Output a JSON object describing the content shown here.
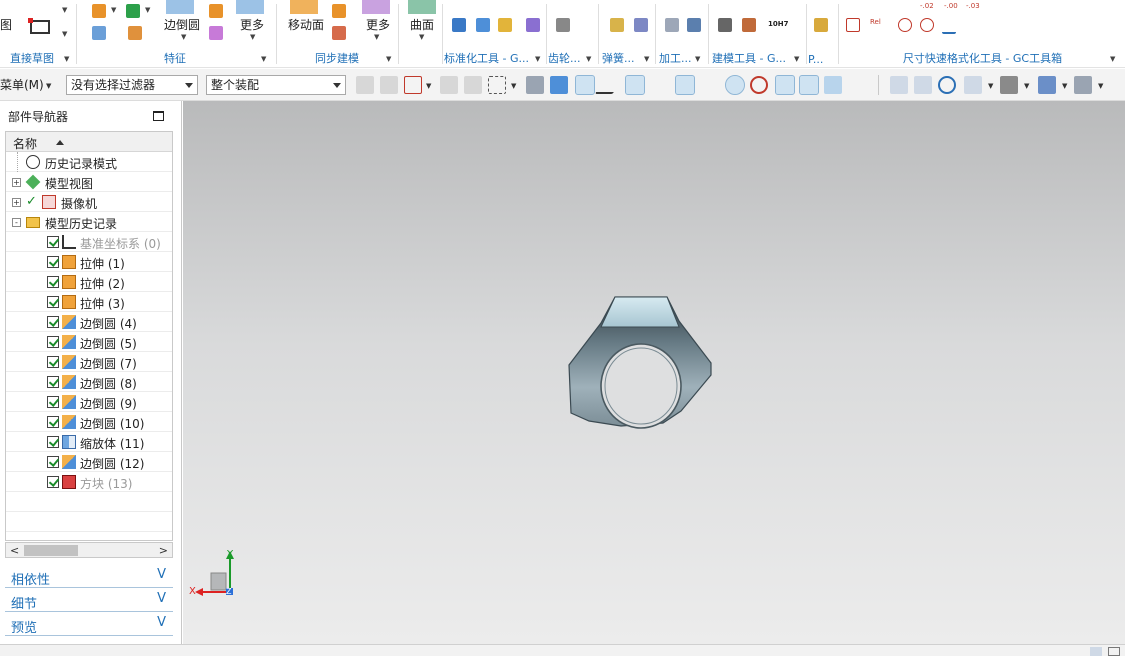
{
  "ribbon": {
    "groups": [
      {
        "id": "sketch",
        "label": "直接草图"
      },
      {
        "id": "feature",
        "label": "特征"
      },
      {
        "id": "sync",
        "label": "同步建模"
      },
      {
        "id": "standard",
        "label": "标准化工具 - G..."
      },
      {
        "id": "gear",
        "label": "齿轮..."
      },
      {
        "id": "spring",
        "label": "弹簧..."
      },
      {
        "id": "machining",
        "label": "加工..."
      },
      {
        "id": "modeling",
        "label": "建模工具 - G..."
      },
      {
        "id": "p",
        "label": "P..."
      },
      {
        "id": "dim",
        "label": "尺寸快速格式化工具 - GC工具箱"
      }
    ],
    "buttons": {
      "edge_blend": "边倒圆",
      "more_feature": "更多",
      "move_face": "移动面",
      "more_sync": "更多",
      "surface": "曲面",
      "sketch_partial": "图"
    },
    "dim_texts": {
      "a": "-.02",
      "b": "-.00",
      "c": "-.03",
      "d": "Rel",
      "e": "10H7"
    }
  },
  "toolbar": {
    "menu": "菜单(M)",
    "filter": "没有选择过滤器",
    "assembly": "整个装配"
  },
  "navigator": {
    "title": "部件导航器",
    "column": "名称",
    "nodes": [
      {
        "label": "历史记录模式",
        "expander": "",
        "icon": "clock-icon"
      },
      {
        "label": "模型视图",
        "expander": "+",
        "icon": "model-views-icon"
      },
      {
        "label": "摄像机",
        "expander": "+",
        "icon": "camera-icon"
      },
      {
        "label": "模型历史记录",
        "expander": "-",
        "icon": "folder-icon"
      }
    ],
    "features": [
      {
        "label": "基准坐标系 (0)",
        "icon": "datum-csys-icon",
        "dim": true
      },
      {
        "label": "拉伸 (1)",
        "icon": "extrude-icon",
        "dim": false
      },
      {
        "label": "拉伸 (2)",
        "icon": "extrude-icon",
        "dim": false
      },
      {
        "label": "拉伸 (3)",
        "icon": "extrude-icon",
        "dim": false
      },
      {
        "label": "边倒圆 (4)",
        "icon": "edge-blend-icon",
        "dim": false
      },
      {
        "label": "边倒圆 (5)",
        "icon": "edge-blend-icon",
        "dim": false
      },
      {
        "label": "边倒圆 (7)",
        "icon": "edge-blend-icon",
        "dim": false
      },
      {
        "label": "边倒圆 (8)",
        "icon": "edge-blend-icon",
        "dim": false
      },
      {
        "label": "边倒圆 (9)",
        "icon": "edge-blend-icon",
        "dim": false
      },
      {
        "label": "边倒圆 (10)",
        "icon": "edge-blend-icon",
        "dim": false
      },
      {
        "label": "缩放体 (11)",
        "icon": "scale-body-icon",
        "dim": false
      },
      {
        "label": "边倒圆 (12)",
        "icon": "edge-blend-icon",
        "dim": false
      },
      {
        "label": "方块 (13)",
        "icon": "block-icon",
        "dim": true
      }
    ],
    "panels": [
      "相依性",
      "细节",
      "预览"
    ]
  },
  "viewport": {
    "triad": {
      "x": "X",
      "y": "Y",
      "z": "Z"
    }
  },
  "colors": {
    "accent": "#1f6fb6",
    "check": "#1a8c2a"
  }
}
